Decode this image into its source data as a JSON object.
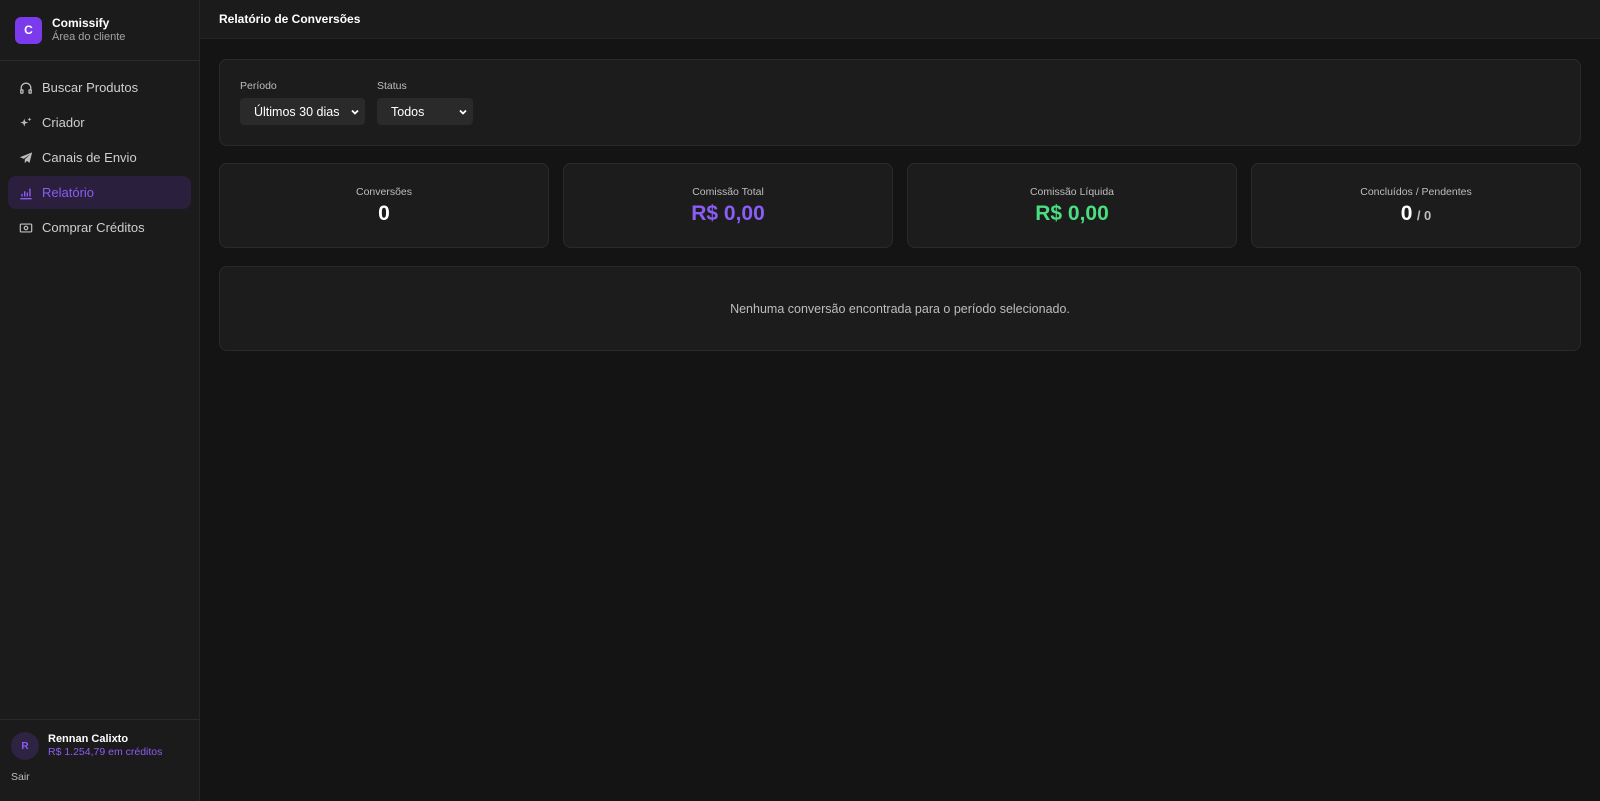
{
  "brand": {
    "logo_letter": "C",
    "name": "Comissify",
    "subtitle": "Área do cliente",
    "accent": "#7c3aed"
  },
  "nav": {
    "items": [
      {
        "label": "Buscar Produtos",
        "icon": "headphones-icon",
        "active": false
      },
      {
        "label": "Criador",
        "icon": "sparkles-icon",
        "active": false
      },
      {
        "label": "Canais de Envio",
        "icon": "send-icon",
        "active": false
      },
      {
        "label": "Relatório",
        "icon": "bar-chart-icon",
        "active": true
      },
      {
        "label": "Comprar Créditos",
        "icon": "money-icon",
        "active": false
      }
    ]
  },
  "user": {
    "initial": "R",
    "name": "Rennan Calixto",
    "credits": "R$ 1.254,79 em créditos",
    "logout": "Sair"
  },
  "header": {
    "title": "Relatório de Conversões"
  },
  "filters": {
    "period": {
      "label": "Período",
      "value": "Últimos 30 dias"
    },
    "status": {
      "label": "Status",
      "value": "Todos"
    }
  },
  "stats": {
    "conversions": {
      "label": "Conversões",
      "value": "0"
    },
    "total_commission": {
      "label": "Comissão Total",
      "value": "R$ 0,00",
      "color": "#8b5cf6"
    },
    "net_commission": {
      "label": "Comissão Líquida",
      "value": "R$ 0,00",
      "color": "#4ade80"
    },
    "completed_pending": {
      "label": "Concluídos / Pendentes",
      "value": "0",
      "sub": "/ 0"
    }
  },
  "empty_state": {
    "message": "Nenhuma conversão encontrada para o período selecionado."
  }
}
